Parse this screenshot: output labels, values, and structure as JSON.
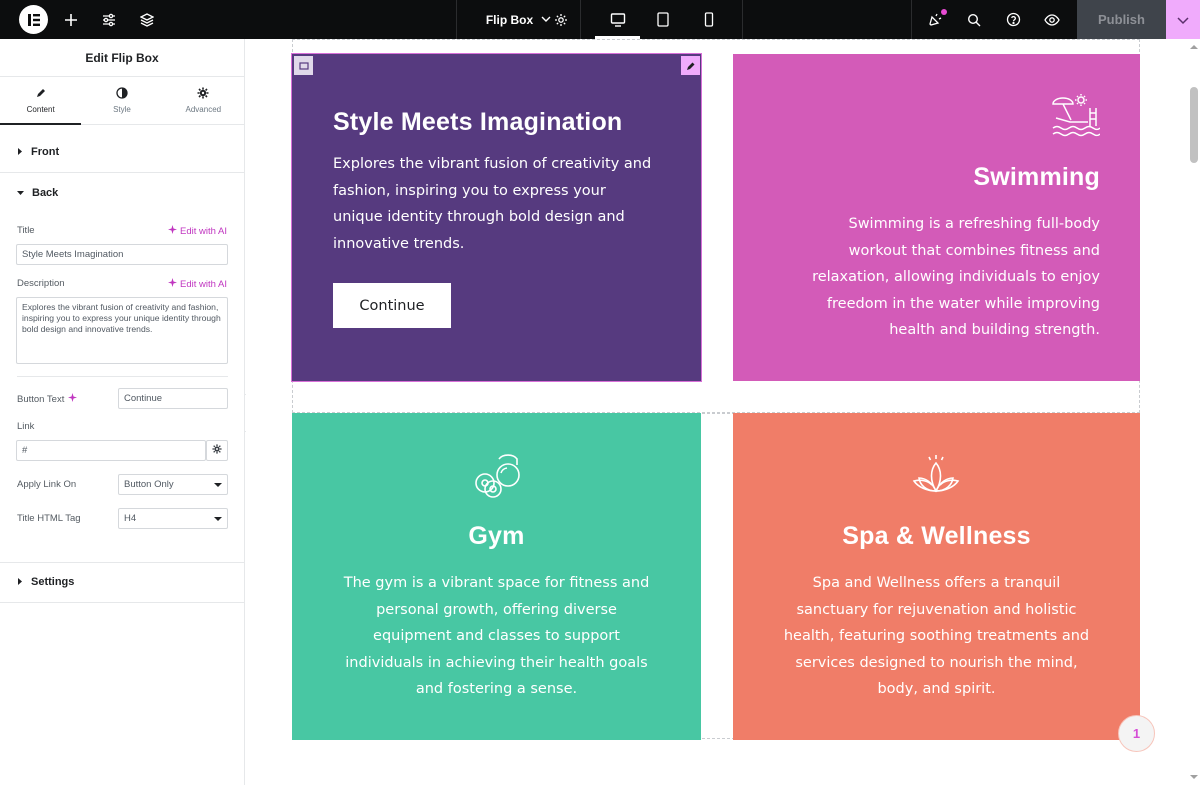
{
  "topbar": {
    "doc_title": "Flip Box",
    "publish_label": "Publish",
    "icons": [
      "elementor-logo-icon",
      "add-icon",
      "settings-sliders-icon",
      "layers-icon",
      "gear-icon",
      "desktop-icon",
      "tablet-icon",
      "mobile-icon",
      "notifications-icon",
      "search-icon",
      "help-icon",
      "preview-eye-icon",
      "chevron-down-icon"
    ]
  },
  "panel": {
    "title": "Edit Flip Box",
    "tabs": [
      {
        "label": "Content",
        "icon": "pencil-icon",
        "active": true
      },
      {
        "label": "Style",
        "icon": "contrast-icon",
        "active": false
      },
      {
        "label": "Advanced",
        "icon": "gear-icon",
        "active": false
      }
    ],
    "sections": {
      "front": "Front",
      "back": "Back",
      "settings": "Settings"
    },
    "controls": {
      "title_label": "Title",
      "title_value": "Style Meets Imagination",
      "edit_ai": "Edit with AI",
      "description_label": "Description",
      "description_value": "Explores the vibrant fusion of creativity and fashion, inspiring you to express your unique identity through bold design and innovative trends.",
      "button_text_label": "Button Text",
      "button_text_value": "Continue",
      "link_label": "Link",
      "link_value": "#",
      "apply_link_label": "Apply Link On",
      "apply_link_value": "Button Only",
      "title_tag_label": "Title HTML Tag",
      "title_tag_value": "H4"
    }
  },
  "cards": [
    {
      "title": "Style Meets Imagination",
      "description": "Explores the vibrant fusion of creativity and fashion, inspiring you to express your unique identity through bold design and innovative trends.",
      "lines": [
        "Explores the vibrant fusion of creativity and",
        "fashion, inspiring you to express your",
        "unique identity through bold design and",
        "innovative trends."
      ],
      "button": "Continue",
      "color": "#563a7f"
    },
    {
      "title": "Swimming",
      "icon": "beach-pool-icon",
      "lines": [
        "Swimming is a refreshing full-body",
        "workout that combines fitness and",
        "relaxation, allowing individuals to enjoy",
        "freedom in the water while improving",
        "health and building strength."
      ],
      "color": "#d35bb8"
    },
    {
      "title": "Gym",
      "icon": "kettlebell-icon",
      "lines": [
        "The gym is a vibrant space for fitness and",
        "personal growth, offering diverse",
        "equipment and classes to support",
        "individuals in achieving their health goals",
        "and fostering a sense."
      ],
      "color": "#48c7a3"
    },
    {
      "title": "Spa & Wellness",
      "icon": "lotus-icon",
      "lines": [
        "Spa and Wellness offers a tranquil",
        "sanctuary for rejuvenation and holistic",
        "health, featuring soothing treatments and",
        "services designed to nourish the mind,",
        "body, and spirit."
      ],
      "color": "#f07d68"
    }
  ],
  "page_badge": "1",
  "colors": {
    "accent": "#d64dd6",
    "topbar": "#0c0d0e",
    "publish_bg": "#3f444b",
    "publish_caret": "#f0abfc"
  }
}
